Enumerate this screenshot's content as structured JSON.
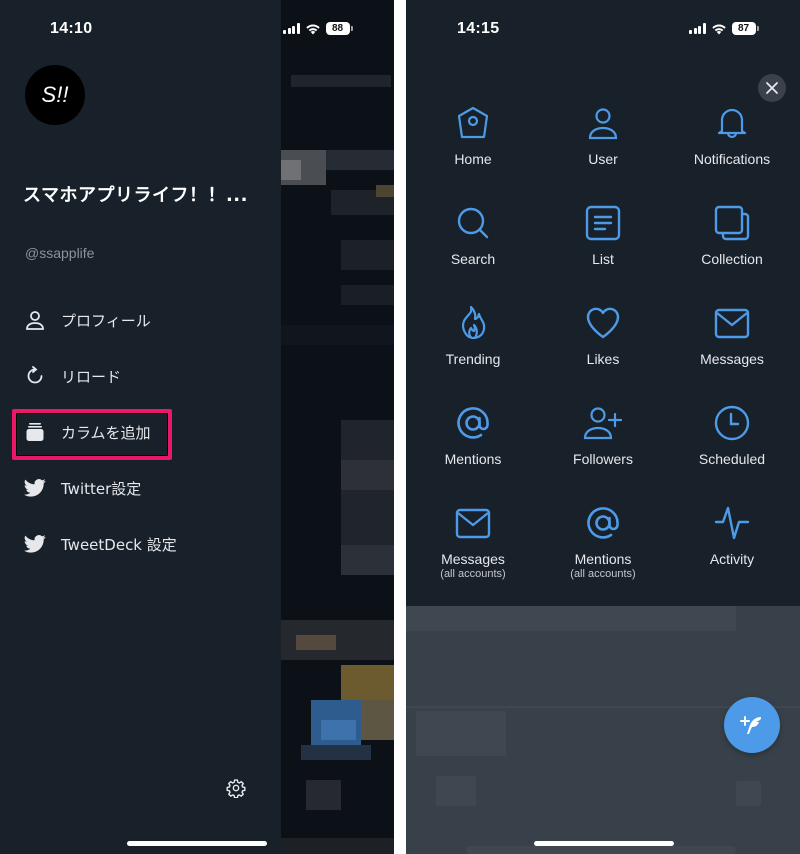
{
  "left_screen": {
    "status": {
      "time": "14:10",
      "battery": "88"
    },
    "profile": {
      "avatar_text": "S!!",
      "display_name": "スマホアプリライフ！！...",
      "handle": "@ssapplife"
    },
    "menu": [
      {
        "label": "プロフィール",
        "icon": "user-icon"
      },
      {
        "label": "リロード",
        "icon": "reload-icon"
      },
      {
        "label": "カラムを追加",
        "icon": "add-column-icon",
        "highlighted": true
      },
      {
        "label": "Twitter設定",
        "icon": "twitter-bird-icon"
      },
      {
        "label": "TweetDeck 設定",
        "icon": "twitter-bird-icon"
      }
    ],
    "settings_icon": "gear-icon",
    "highlight_color": "#ea1866"
  },
  "right_screen": {
    "status": {
      "time": "14:15",
      "battery": "87"
    },
    "close_icon": "close-icon",
    "accent_color": "#4d9be8",
    "columns": [
      {
        "label": "Home",
        "icon": "home-icon"
      },
      {
        "label": "User",
        "icon": "user-icon"
      },
      {
        "label": "Notifications",
        "icon": "bell-icon"
      },
      {
        "label": "Search",
        "icon": "search-icon"
      },
      {
        "label": "List",
        "icon": "list-icon"
      },
      {
        "label": "Collection",
        "icon": "collection-icon"
      },
      {
        "label": "Trending",
        "icon": "flame-icon"
      },
      {
        "label": "Likes",
        "icon": "heart-icon"
      },
      {
        "label": "Messages",
        "icon": "envelope-icon"
      },
      {
        "label": "Mentions",
        "icon": "at-icon"
      },
      {
        "label": "Followers",
        "icon": "follower-add-icon"
      },
      {
        "label": "Scheduled",
        "icon": "clock-icon"
      },
      {
        "label": "Messages",
        "sublabel": "(all accounts)",
        "icon": "envelope-icon"
      },
      {
        "label": "Mentions",
        "sublabel": "(all accounts)",
        "icon": "at-icon"
      },
      {
        "label": "Activity",
        "icon": "activity-icon"
      }
    ],
    "compose_icon": "compose-tweet-icon"
  }
}
